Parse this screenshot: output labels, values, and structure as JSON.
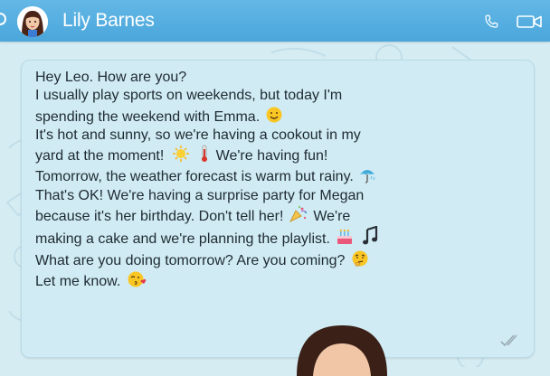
{
  "header": {
    "contact_name": "Lily Barnes",
    "icons": [
      "back-icon",
      "avatar",
      "phone-icon",
      "video-call-icon"
    ],
    "bar_color": "#4aa6db"
  },
  "message": {
    "lines": [
      "Hey Leo. How are you?",
      "I usually play sports on weekends, but today I'm",
      "spending the weekend with Emma.",
      "It's hot and sunny, so we're having a cookout in my",
      "yard at the moment!",
      "We're having fun!",
      "Tomorrow, the weather forecast is warm but rainy.",
      "That's OK! We're having a surprise party for Megan",
      "because it's her birthday. Don't tell her!",
      "We're",
      "making a cake and we're planning the playlist.",
      "What are you doing tomorrow? Are you coming?",
      "Let me know."
    ],
    "emojis": [
      "smile-emoji",
      "sun-emoji",
      "thermometer-emoji",
      "umbrella-emoji",
      "party-popper-emoji",
      "cake-emoji",
      "music-note-emoji",
      "thinking-emoji",
      "kiss-emoji"
    ],
    "status": "read-ticks"
  }
}
